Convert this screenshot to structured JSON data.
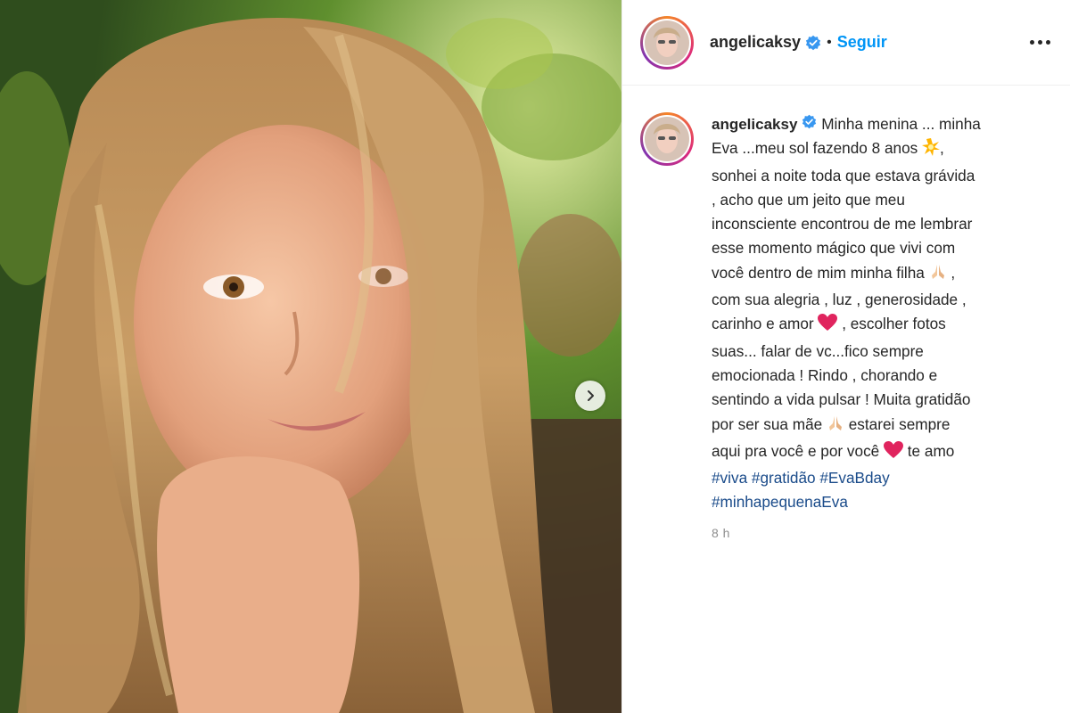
{
  "post": {
    "username": "angelicaksy",
    "follow_label": "Seguir",
    "separator": "•",
    "more_icon": "more-horizontal-icon",
    "caption_lines": [
      "Minha menina ... minha",
      "Eva ...meu sol fazendo 8 anos ",
      "sonhei a noite toda que estava grávida",
      ", acho que um jeito que meu",
      "inconsciente encontrou de me lembrar",
      "esse momento mágico que vivi com",
      "você dentro de mim minha filha ",
      " com sua alegria , luz , generosidade ,",
      "carinho e amor ",
      "suas... falar de vc...fico sempre",
      "emocionada ! Rindo , chorando e",
      "sentindo a vida pulsar ! Muita gratidão",
      "por ser sua mãe ",
      "aqui pra você e por você ",
      " te amo"
    ],
    "caption_parts": {
      "l2_tail": ",",
      "l7_tail": " ,",
      "l9_tail": " , escolher fotos",
      "l13_tail": " estarei sempre"
    },
    "hashtags": [
      "#viva",
      "#gratidão",
      "#EvaBday",
      "#minhapequenaEva"
    ],
    "time": "8 h",
    "emojis": [
      "sparkle-burst-icon",
      "praying-hands-icon",
      "red-heart-icon"
    ],
    "colors": {
      "link_blue": "#0095f6",
      "hashtag": "#1a4b8a",
      "verified": "#3897f0",
      "heart": "#e0245e"
    }
  }
}
